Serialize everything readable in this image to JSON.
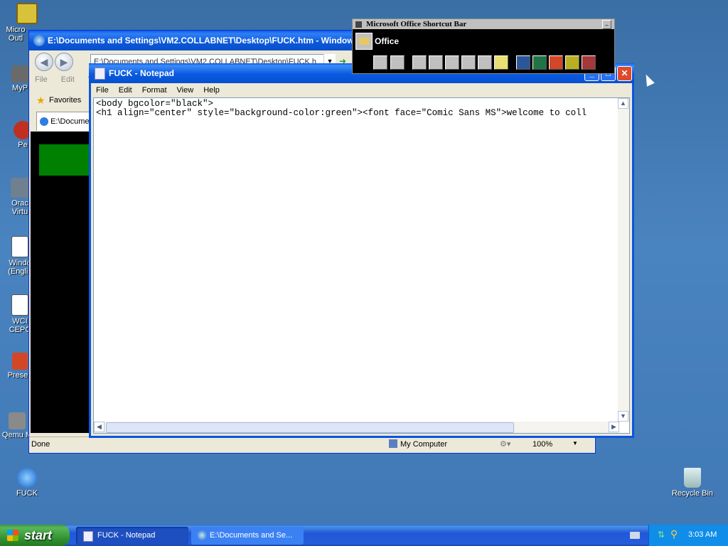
{
  "desktop": {
    "icons": [
      {
        "label": "Micro Outl"
      },
      {
        "label": "MyP"
      },
      {
        "label": "Pe"
      },
      {
        "label": "Orac Virtu"
      },
      {
        "label": "Windo (Englis"
      },
      {
        "label": "WCI CEPC"
      },
      {
        "label": "Presen"
      },
      {
        "label": "Qemu M"
      },
      {
        "label": "FUCK"
      },
      {
        "label": "Recycle Bin"
      }
    ]
  },
  "ie": {
    "title": "E:\\Documents and Settings\\VM2.COLLABNET\\Desktop\\FUCK.htm - Windows Intern",
    "address": "E:\\Documents and Settings\\VM2.COLLABNET\\Desktop\\FUCK.h",
    "menu": [
      "File",
      "Edit",
      "V"
    ],
    "favorites_label": "Favorites",
    "tab_label": "E:\\Docume",
    "status_left": "Done",
    "status_zone": "My Computer",
    "zoom": "100%"
  },
  "notepad": {
    "title": "FUCK - Notepad",
    "menu": [
      "File",
      "Edit",
      "Format",
      "View",
      "Help"
    ],
    "lines": [
      "<body bgcolor=\"black\">",
      "<h1 align=\"center\" style=\"background-color:green\"><font face=\"Comic Sans MS\">welcome to coll"
    ]
  },
  "office_bar": {
    "title": "Microsoft Office Shortcut Bar",
    "folder_label": "Office"
  },
  "taskbar": {
    "start_label": "start",
    "tasks": [
      "FUCK - Notepad",
      "E:\\Documents and Se..."
    ],
    "clock": "3:03 AM"
  }
}
